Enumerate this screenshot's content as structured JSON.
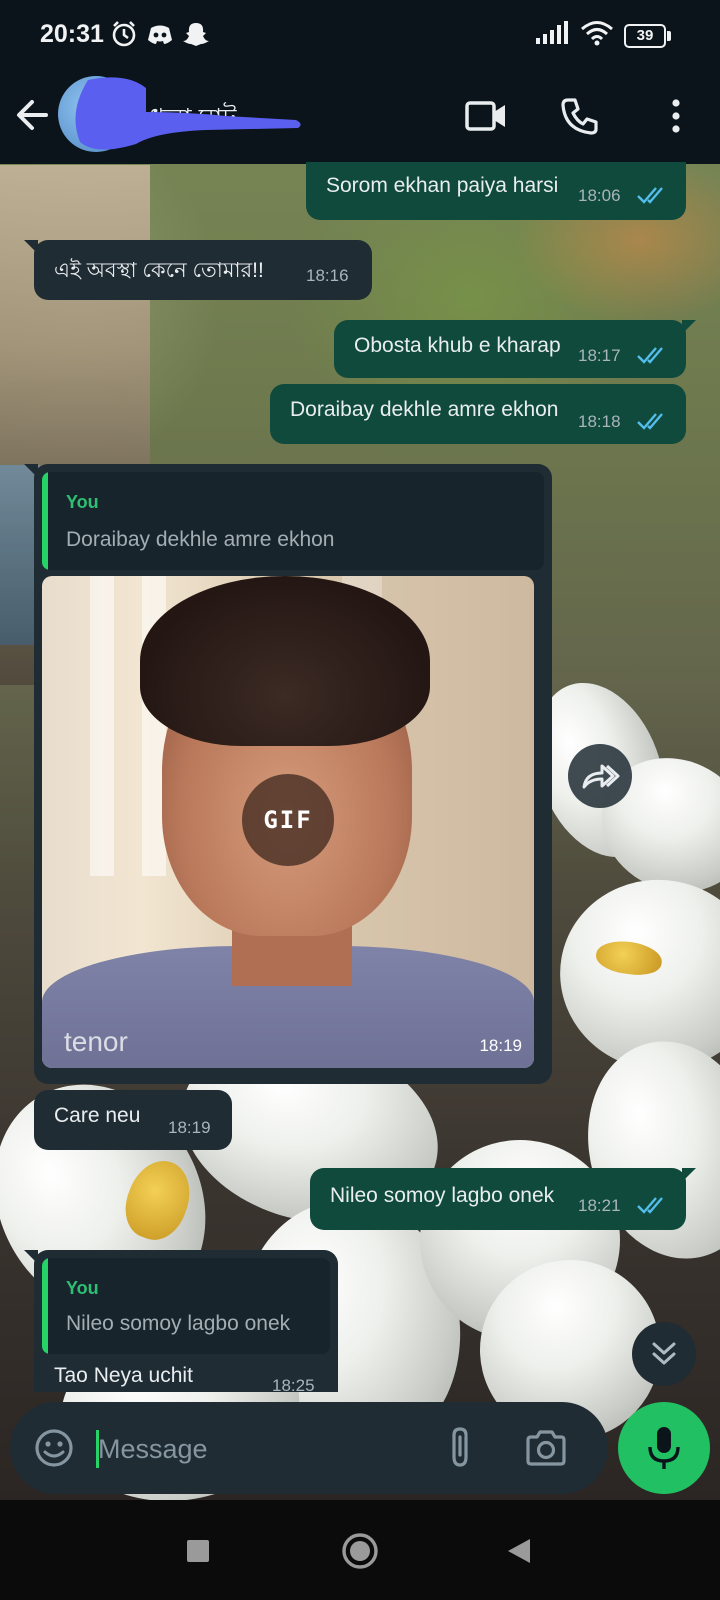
{
  "status_bar": {
    "time": "20:31",
    "battery": "39",
    "icons": [
      "alarm-icon",
      "discord-icon",
      "snapchat-icon",
      "signal-icon",
      "wifi-icon",
      "battery-icon"
    ]
  },
  "header": {
    "contact_name": "ধুলা ঘাট",
    "icons": [
      "back-arrow-icon",
      "video-call-icon",
      "voice-call-icon",
      "more-vert-icon"
    ]
  },
  "messages": [
    {
      "dir": "out",
      "text": "Sorom ekhan paiya harsi",
      "time": "18:06",
      "status": "read"
    },
    {
      "dir": "in",
      "text": "এই অবস্থা কেনে তোমার!!",
      "time": "18:16"
    },
    {
      "dir": "out",
      "text": "Obosta khub e kharap",
      "time": "18:17",
      "status": "read"
    },
    {
      "dir": "out",
      "text": "Doraibay dekhle amre ekhon",
      "time": "18:18",
      "status": "read"
    },
    {
      "dir": "in",
      "type": "gif",
      "quote": {
        "author": "You",
        "text": "Doraibay dekhle amre ekhon"
      },
      "gif_badge": "GIF",
      "watermark": "tenor",
      "time": "18:19"
    },
    {
      "dir": "in",
      "text": "Care neu",
      "time": "18:19"
    },
    {
      "dir": "out",
      "text": "Nileo somoy lagbo onek",
      "time": "18:21",
      "status": "read"
    },
    {
      "dir": "in",
      "quote": {
        "author": "You",
        "text": "Nileo somoy lagbo onek"
      },
      "text": "Tao Neya uchit",
      "time": "18:25"
    }
  ],
  "composer": {
    "placeholder": "Message",
    "icons": [
      "emoji-icon",
      "attach-icon",
      "camera-icon",
      "mic-icon"
    ]
  },
  "colors": {
    "outgoing_bubble": "#0f4a3c",
    "incoming_bubble": "#1f2c34",
    "accent": "#25d366",
    "read_ticks": "#53bdeb",
    "bar_background": "#0b141a"
  }
}
